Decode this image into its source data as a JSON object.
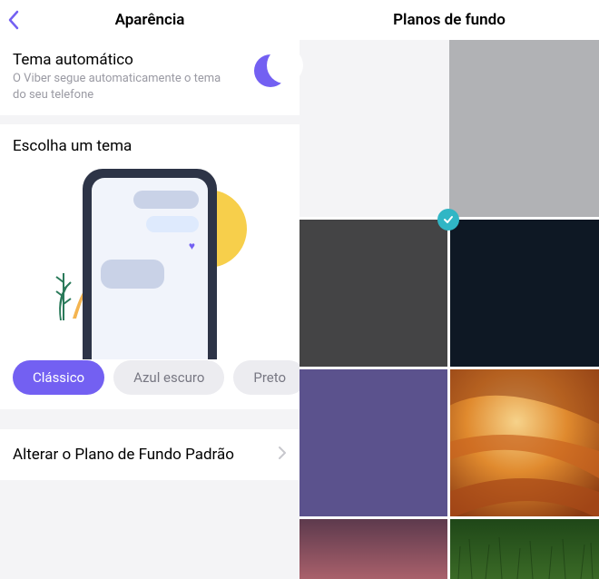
{
  "left": {
    "header_title": "Aparência",
    "auto_theme": {
      "title": "Tema automático",
      "description": "O Viber segue automaticamente o tema do seu telefone"
    },
    "choose_title": "Escolha um tema",
    "themes": [
      {
        "label": "Clássico",
        "selected": true
      },
      {
        "label": "Azul escuro",
        "selected": false
      },
      {
        "label": "Preto",
        "selected": false
      }
    ],
    "change_bg_label": "Alterar o Plano de Fundo Padrão"
  },
  "right": {
    "header_title": "Planos de fundo",
    "tiles": [
      {
        "name": "bg-light-grey",
        "color": "#b1b2b5",
        "selected": true
      },
      {
        "name": "bg-dark-grey",
        "color": "#444445"
      },
      {
        "name": "bg-midnight",
        "color": "#0e1824"
      },
      {
        "name": "bg-purple",
        "color": "#5b528d"
      },
      {
        "name": "bg-orange-canyon",
        "color": "orange-canyon"
      },
      {
        "name": "bg-dusk",
        "color": "dusk"
      },
      {
        "name": "bg-green-grass",
        "color": "green-grass"
      }
    ]
  },
  "colors": {
    "accent": "#7360f2"
  }
}
